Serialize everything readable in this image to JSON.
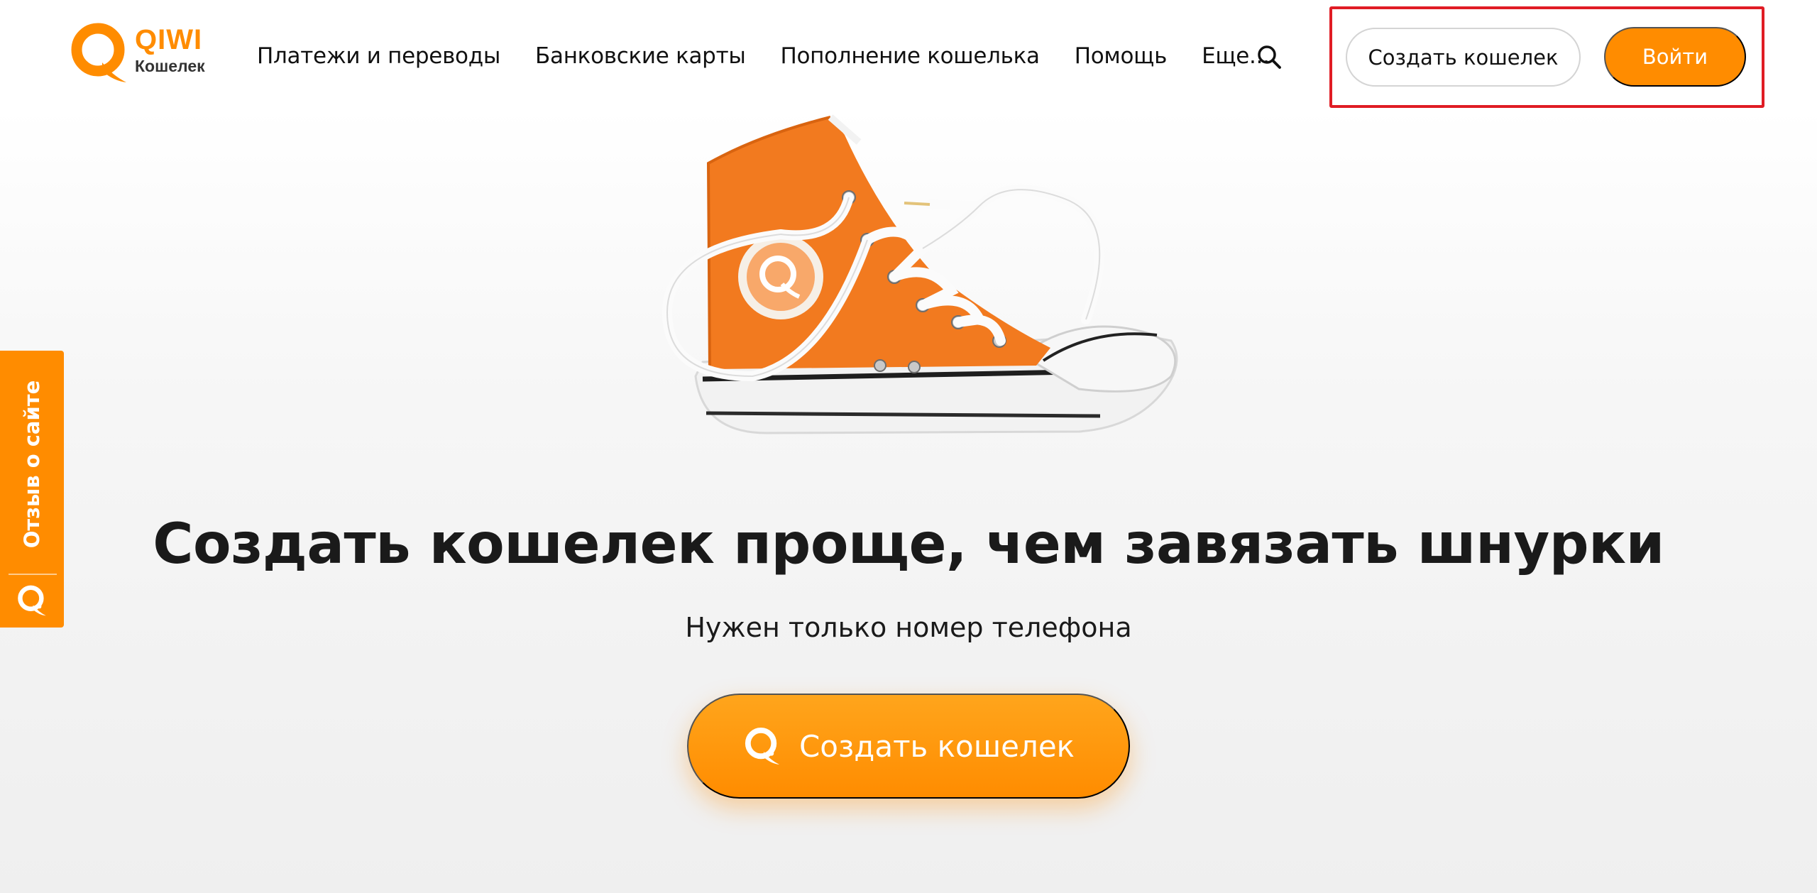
{
  "brand": {
    "name": "QIWI",
    "subtitle": "Кошелек",
    "color": "#ff8c00"
  },
  "nav": {
    "items": [
      {
        "label": "Платежи и переводы"
      },
      {
        "label": "Банковские карты"
      },
      {
        "label": "Пополнение кошелька"
      },
      {
        "label": "Помощь"
      },
      {
        "label": "Еще..."
      }
    ],
    "search_icon": "search-icon"
  },
  "auth": {
    "create_label": "Создать кошелек",
    "login_label": "Войти",
    "highlight_color": "#e01c24"
  },
  "feedback": {
    "label": "Отзыв о сайте",
    "icon": "qiwi-q-icon"
  },
  "hero": {
    "image": "orange-sneaker-image",
    "title": "Создать кошелек проще, чем завязать шнурки",
    "subtitle": "Нужен только номер телефона",
    "cta_label": "Создать кошелек",
    "cta_icon": "qiwi-q-icon"
  }
}
